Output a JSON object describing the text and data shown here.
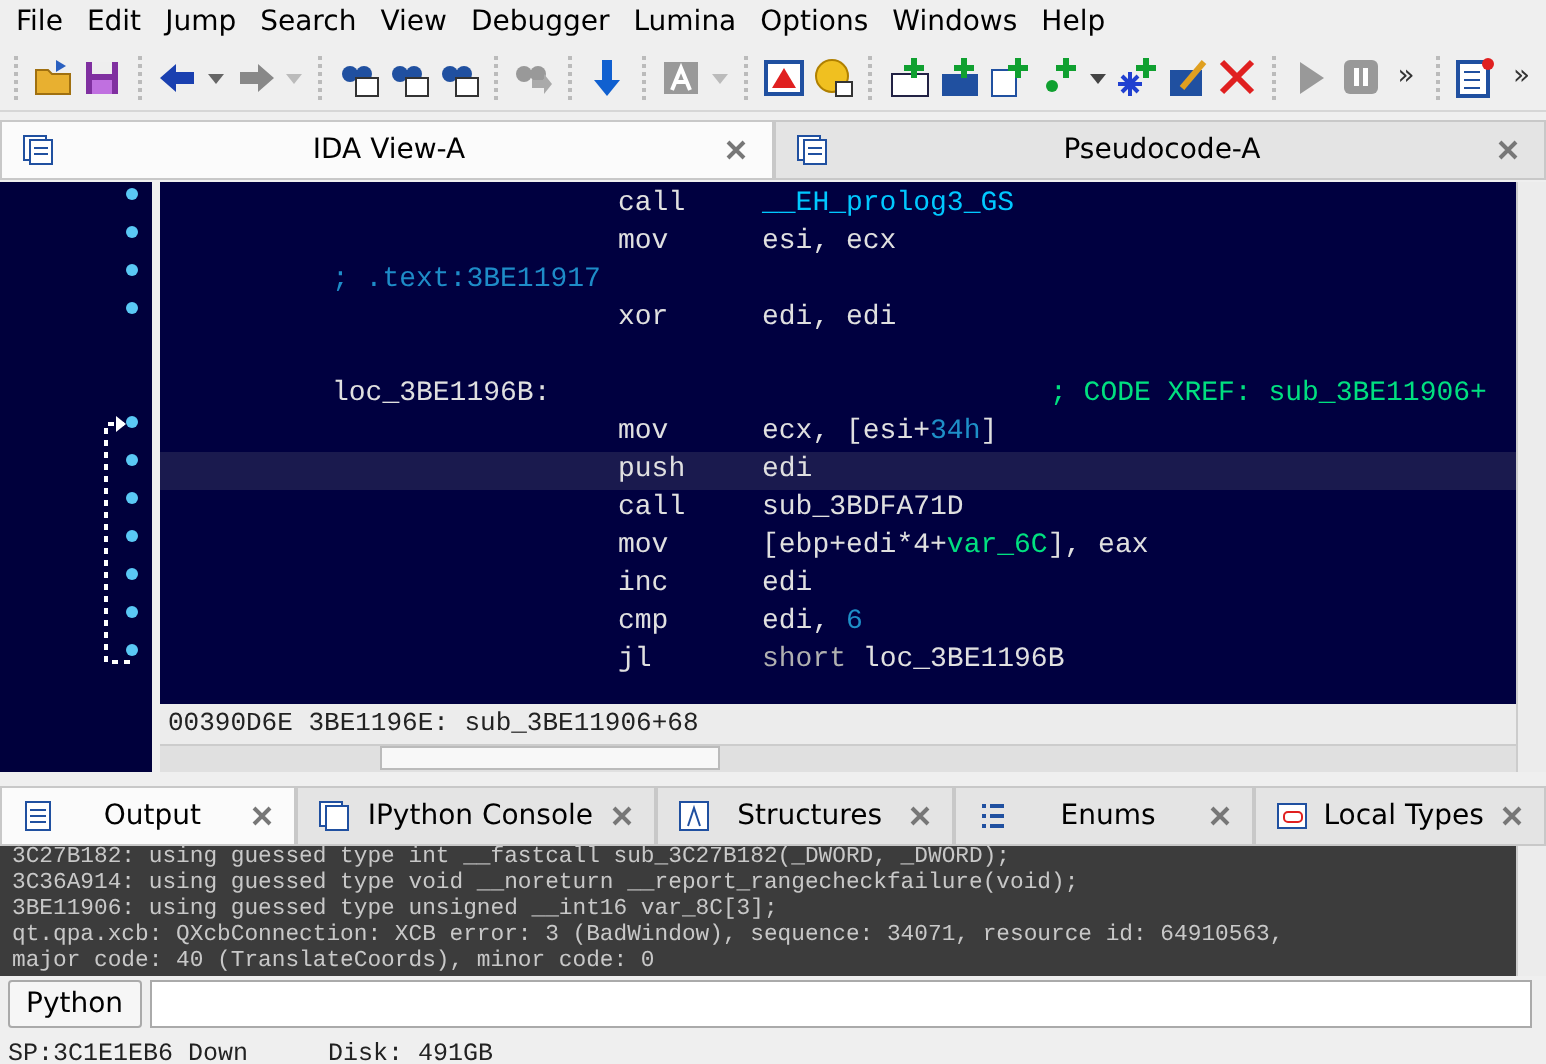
{
  "menu": [
    "File",
    "Edit",
    "Jump",
    "Search",
    "View",
    "Debugger",
    "Lumina",
    "Options",
    "Windows",
    "Help"
  ],
  "toolbar": {
    "overflow": [
      "»",
      "»"
    ]
  },
  "top_tabs": [
    {
      "label": "IDA View-A",
      "selected": true
    },
    {
      "label": "Pseudocode-A",
      "selected": false
    }
  ],
  "disassembly": {
    "lines": [
      {
        "kind": "instr",
        "mnemonic": "call",
        "operands": [
          {
            "kind": "name",
            "text": "__EH_prolog3_GS"
          }
        ],
        "selected": false
      },
      {
        "kind": "instr",
        "mnemonic": "mov",
        "operands": [
          {
            "kind": "plain",
            "text": "esi, ecx"
          }
        ],
        "selected": false
      },
      {
        "kind": "comment",
        "text": "; .text:3BE11917",
        "selected": false
      },
      {
        "kind": "instr",
        "mnemonic": "xor",
        "operands": [
          {
            "kind": "plain",
            "text": "edi, edi"
          }
        ],
        "selected": false
      },
      {
        "kind": "blank",
        "selected": false
      },
      {
        "kind": "label",
        "text": "loc_3BE1196B:",
        "xref": "; CODE XREF: sub_3BE11906+",
        "selected": false
      },
      {
        "kind": "instr",
        "mnemonic": "mov",
        "operands": [
          {
            "kind": "plain",
            "text": "ecx, [esi+"
          },
          {
            "kind": "number",
            "text": "34h"
          },
          {
            "kind": "plain",
            "text": "]"
          }
        ],
        "selected": false
      },
      {
        "kind": "instr",
        "mnemonic": "push",
        "operands": [
          {
            "kind": "plain",
            "text": "edi"
          }
        ],
        "selected": true
      },
      {
        "kind": "instr",
        "mnemonic": "call",
        "operands": [
          {
            "kind": "plain",
            "text": "sub_3BDFA71D"
          }
        ],
        "selected": false
      },
      {
        "kind": "instr",
        "mnemonic": "mov",
        "operands": [
          {
            "kind": "plain",
            "text": "[ebp+edi*4+"
          },
          {
            "kind": "var",
            "text": "var_6C"
          },
          {
            "kind": "plain",
            "text": "], eax"
          }
        ],
        "selected": false
      },
      {
        "kind": "instr",
        "mnemonic": "inc",
        "operands": [
          {
            "kind": "plain",
            "text": "edi"
          }
        ],
        "selected": false
      },
      {
        "kind": "instr",
        "mnemonic": "cmp",
        "operands": [
          {
            "kind": "plain",
            "text": "edi, "
          },
          {
            "kind": "number",
            "text": "6"
          }
        ],
        "selected": false
      },
      {
        "kind": "instr",
        "mnemonic": "jl",
        "operands": [
          {
            "kind": "keyword",
            "text": "short "
          },
          {
            "kind": "plain",
            "text": "loc_3BE1196B"
          }
        ],
        "selected": false
      }
    ],
    "location": "00390D6E 3BE1196E: sub_3BE11906+68"
  },
  "bottom_tabs": [
    {
      "label": "Output",
      "selected": true
    },
    {
      "label": "IPython Console",
      "selected": false
    },
    {
      "label": "Structures",
      "selected": false
    },
    {
      "label": "Enums",
      "selected": false
    },
    {
      "label": "Local Types",
      "selected": false
    }
  ],
  "output": [
    "3C27B182: using guessed type int __fastcall sub_3C27B182(_DWORD, _DWORD);",
    "3C36A914: using guessed type void __noreturn __report_rangecheckfailure(void);",
    "3BE11906: using guessed type unsigned __int16 var_8C[3];",
    "qt.qpa.xcb: QXcbConnection: XCB error: 3 (BadWindow), sequence: 34071, resource id: 64910563,",
    "major code: 40 (TranslateCoords), minor code: 0"
  ],
  "command": {
    "language_button": "Python"
  },
  "status_bar": [
    "SP:3C1E1EB6 Down",
    "Disk: 491GB"
  ]
}
